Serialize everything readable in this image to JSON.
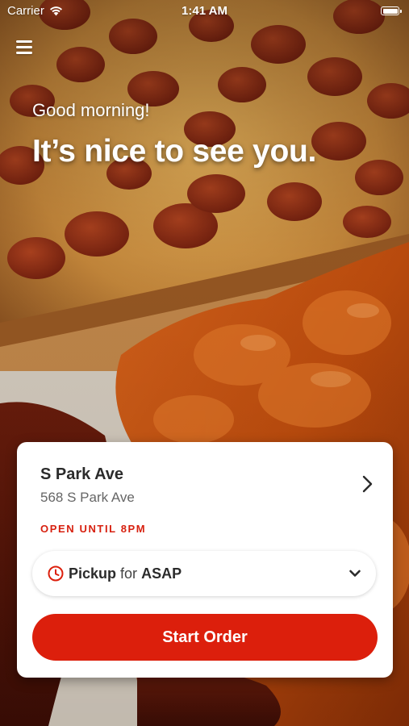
{
  "status_bar": {
    "carrier": "Carrier",
    "time": "1:41 AM"
  },
  "icons": {
    "menu": "hamburger-menu-icon",
    "wifi": "wifi-icon",
    "battery": "battery-icon",
    "chevron_right": "chevron-right-icon",
    "clock": "clock-icon",
    "chevron_down": "chevron-down-icon"
  },
  "hero": {
    "greeting": "Good morning!",
    "headline": "It’s nice to see you."
  },
  "store_card": {
    "name": "S Park Ave",
    "address": "568 S Park Ave",
    "hours": "OPEN UNTIL 8PM",
    "order_mode": {
      "mode": "Pickup",
      "connector": "for",
      "time": "ASAP"
    },
    "start_order_label": "Start Order"
  },
  "colors": {
    "accent_red": "#dc1f0c",
    "hours_red": "#d7200f",
    "card_bg": "#ffffff",
    "text_dark": "#2b2b2b",
    "text_muted": "#666666"
  }
}
